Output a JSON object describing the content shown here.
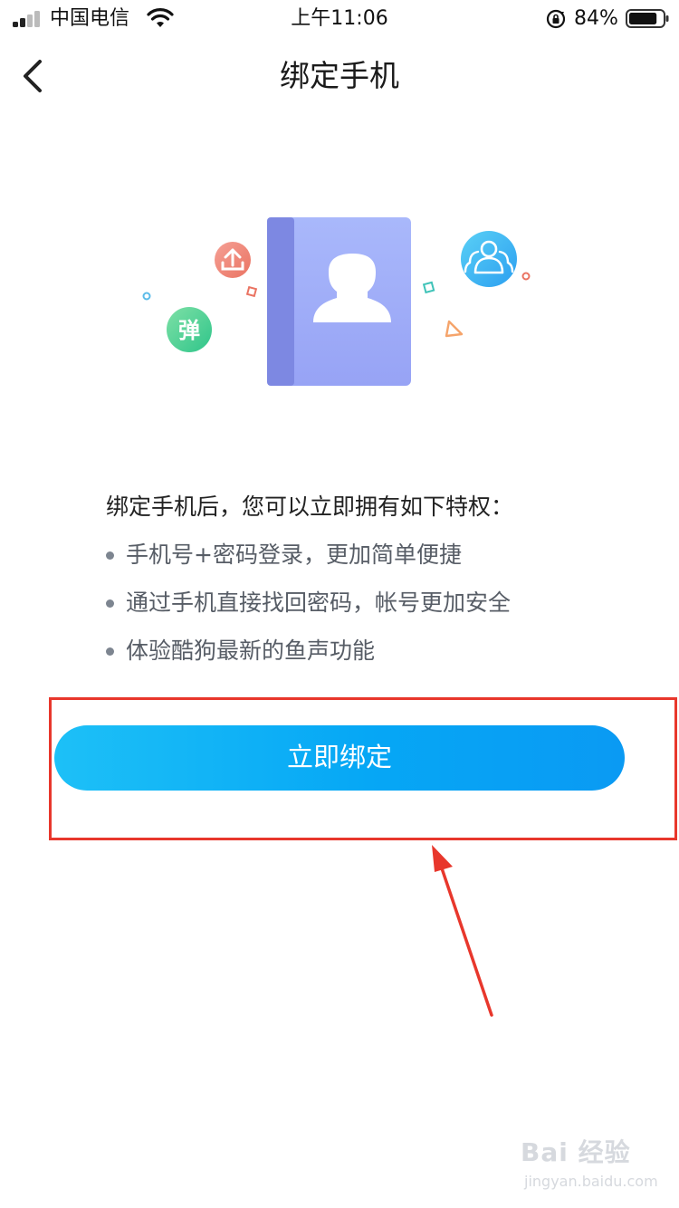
{
  "status_bar": {
    "carrier": "中国电信",
    "time": "上午11:06",
    "battery_percent": "84%",
    "battery_level": 0.84
  },
  "nav": {
    "title": "绑定手机"
  },
  "illustration": {
    "danmaku_badge": "弹"
  },
  "privileges": {
    "intro": "绑定手机后，您可以立即拥有如下特权：",
    "items": [
      {
        "text": "手机号+密码登录，更加简单便捷"
      },
      {
        "text": "通过手机直接找回密码，帐号更加安全"
      },
      {
        "text": "体验酷狗最新的鱼声功能"
      }
    ]
  },
  "bind_button": {
    "label": "立即绑定"
  },
  "watermark": {
    "text": "Bai 经验",
    "sub": "jingyan.baidu.com"
  },
  "colors": {
    "accent": "#06a7f5",
    "annotation": "#e8372c"
  }
}
